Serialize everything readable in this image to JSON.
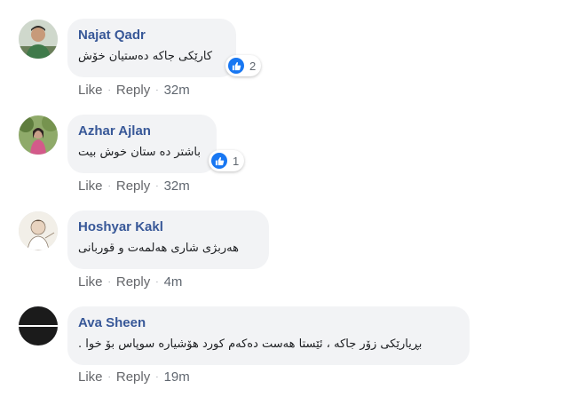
{
  "comments": [
    {
      "author": "Najat Qadr",
      "text": "کارێکی جاکە دەستیان خۆش",
      "reaction_count": "2",
      "like_label": "Like",
      "reply_label": "Reply",
      "time": "32m"
    },
    {
      "author": "Azhar Ajlan",
      "text": "باشتر دە ستان خوش بیت",
      "reaction_count": "1",
      "like_label": "Like",
      "reply_label": "Reply",
      "time": "32m"
    },
    {
      "author": "Hoshyar Kakl",
      "text": "هەربژی شاری هەلمەت و قوربانی",
      "like_label": "Like",
      "reply_label": "Reply",
      "time": "4m"
    },
    {
      "author": "Ava Sheen",
      "text": "بڕیارێکی زۆر جاکە ، ئێستا هەست دەکەم کورد هۆشیارە سوپاس بۆ خوا .",
      "like_label": "Like",
      "reply_label": "Reply",
      "time": "19m"
    }
  ],
  "colors": {
    "name": "#385898",
    "bubble": "#f2f3f5",
    "meta": "#606770",
    "like_blue": "#1877f2"
  },
  "icons": [
    "avatar-man-green",
    "avatar-girl-foliage",
    "avatar-boy-drawing",
    "avatar-black-stripe",
    "thumbs-up-icon"
  ]
}
